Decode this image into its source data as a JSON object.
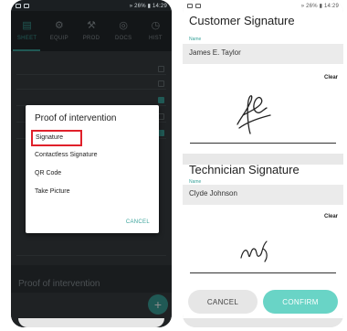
{
  "status": {
    "left_phone": "» 26% ▮ 14:29",
    "right_phone": "» 26% ▮ 14:29"
  },
  "nav": {
    "tabs": [
      {
        "label": "SHEET",
        "icon": "sheet-icon",
        "glyph": "▤"
      },
      {
        "label": "EQUIP",
        "icon": "equipment-icon",
        "glyph": "⚙"
      },
      {
        "label": "PROD",
        "icon": "tools-icon",
        "glyph": "⚒"
      },
      {
        "label": "DOCS",
        "icon": "documents-icon",
        "glyph": "◎"
      },
      {
        "label": "HIST",
        "icon": "history-icon",
        "glyph": "◷"
      }
    ],
    "active": "SHEET"
  },
  "dialog": {
    "title": "Proof of intervention",
    "options": [
      "Signature",
      "Contactless Signature",
      "QR Code",
      "Take Picture"
    ],
    "cancel": "CANCEL"
  },
  "background": {
    "footer_panel_title": "Proof of intervention",
    "fab_glyph": "+"
  },
  "customer": {
    "title": "Customer Signature",
    "name_label": "Name",
    "name": "James E. Taylor",
    "clear": "Clear"
  },
  "technician": {
    "title": "Technician Signature",
    "name_label": "Name",
    "name": "Clyde Johnson",
    "clear": "Clear"
  },
  "actions": {
    "cancel": "CANCEL",
    "confirm": "CONFIRM"
  },
  "colors": {
    "accent": "#3ba39b",
    "confirm": "#69d4c6",
    "highlight": "#e0202a"
  }
}
